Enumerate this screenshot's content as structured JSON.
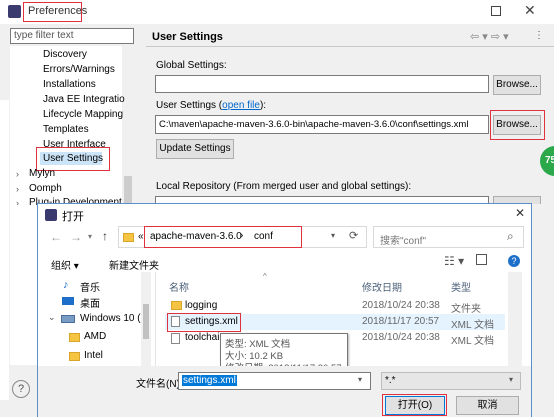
{
  "prefs": {
    "title": "Preferences",
    "filter_placeholder": "type filter text",
    "tree_items": [
      "Discovery",
      "Errors/Warnings",
      "Installations",
      "Java EE Integratio",
      "Lifecycle Mapping",
      "Templates",
      "User Interface",
      "User Settings"
    ],
    "tree_roots": [
      "Mylyn",
      "Oomph",
      "Plug-in Development"
    ],
    "page_title": "User Settings",
    "global_label": "Global Settings:",
    "user_label_prefix": "User Settings (",
    "user_label_link": "open file",
    "user_label_suffix": "):",
    "user_settings_value": "C:\\maven\\apache-maven-3.6.0-bin\\apache-maven-3.6.0\\conf\\settings.xml",
    "browse_label": "Browse...",
    "update_label": "Update Settings",
    "local_repo_label": "Local Repository (From merged user and global settings):",
    "badge": "75"
  },
  "dialog": {
    "title": "打开",
    "path_prefix": "«",
    "path_parts": [
      "apache-maven-3.6.0",
      "conf"
    ],
    "search_placeholder": "搜索\"conf\"",
    "organize_label": "组织 ▾",
    "new_folder_label": "新建文件夹",
    "nav_items": [
      "音乐",
      "桌面",
      "Windows 10 (C",
      "AMD",
      "Intel"
    ],
    "col_name": "名称",
    "col_date": "修改日期",
    "col_type": "类型",
    "files": [
      {
        "name": "logging",
        "date": "2018/10/24 20:38",
        "type": "文件夹"
      },
      {
        "name": "settings.xml",
        "date": "2018/11/17 20:57",
        "type": "XML 文档"
      },
      {
        "name": "toolchai",
        "date": "2018/10/24 20:38",
        "type": "XML 文档"
      }
    ],
    "tooltip": [
      "类型: XML 文档",
      "大小: 10.2 KB",
      "修改日期: 2018/11/17 20:57"
    ],
    "filename_label": "文件名(N):",
    "filename_value": "settings.xml",
    "filter_value": "*.*",
    "open_label": "打开(O)",
    "cancel_label": "取消"
  }
}
